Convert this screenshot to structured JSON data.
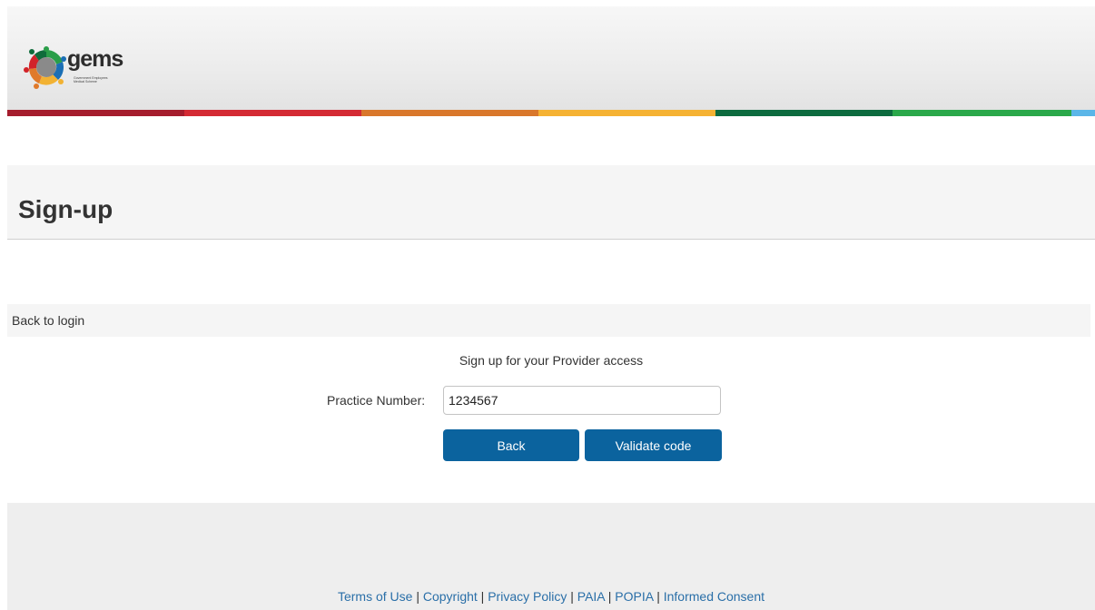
{
  "header": {
    "logo_word": "gems",
    "logo_subtext": "Government Employees Medical Scheme",
    "colorbar": [
      "#a51d2d",
      "#d42a34",
      "#d9772b",
      "#f5b233",
      "#0d6b3f",
      "#2aa84a",
      "#5bb6e8"
    ]
  },
  "page": {
    "title": "Sign-up"
  },
  "nav": {
    "back_to_login": "Back to login"
  },
  "form": {
    "heading": "Sign up for your Provider access",
    "practice_number_label": "Practice Number:",
    "practice_number_value": "1234567",
    "back_button": "Back",
    "validate_button": "Validate code"
  },
  "footer": {
    "links": [
      {
        "label": "Terms of Use"
      },
      {
        "label": "Copyright"
      },
      {
        "label": "Privacy Policy"
      },
      {
        "label": "PAIA"
      },
      {
        "label": "POPIA"
      },
      {
        "label": "Informed Consent"
      }
    ],
    "separator": "|"
  }
}
